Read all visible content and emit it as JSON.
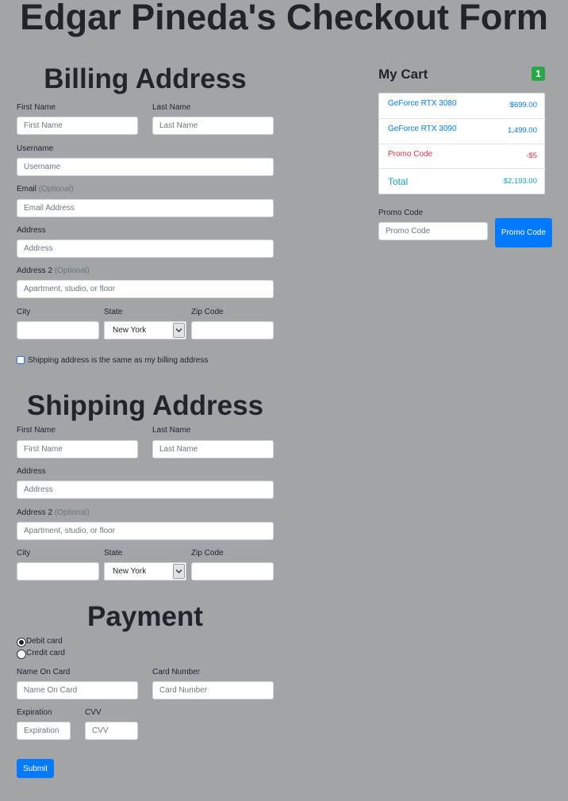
{
  "page_title": "Edgar Pineda's Checkout Form",
  "billing": {
    "title": "Billing Address",
    "first_name_label": "First Name",
    "first_name_placeholder": "First Name",
    "last_name_label": "Last Name",
    "last_name_placeholder": "Last Name",
    "username_label": "Username",
    "username_placeholder": "Username",
    "email_label": "Email",
    "email_optional": "(Optional)",
    "email_placeholder": "Email Address",
    "address_label": "Address",
    "address_placeholder": "Address",
    "address2_label": "Address 2",
    "address2_optional": "(Optional)",
    "address2_placeholder": "Apartment, studio, or floor",
    "city_label": "City",
    "state_label": "State",
    "state_value": "New York",
    "zip_label": "Zip Code",
    "same_address_label": "Shipping address is the same as my billing address",
    "same_address_checked": false
  },
  "shipping": {
    "title": "Shipping Address",
    "first_name_label": "First Name",
    "first_name_placeholder": "First Name",
    "last_name_label": "Last Name",
    "last_name_placeholder": "Last Name",
    "address_label": "Address",
    "address_placeholder": "Address",
    "address2_label": "Address 2",
    "address2_optional": "(Optional)",
    "address2_placeholder": "Apartment, studio, or floor",
    "city_label": "City",
    "state_label": "State",
    "state_value": "New York",
    "zip_label": "Zip Code"
  },
  "payment": {
    "title": "Payment",
    "methods": [
      {
        "label": "Debit card",
        "checked": true
      },
      {
        "label": "Credit card",
        "checked": false
      }
    ],
    "name_on_card_label": "Name On Card",
    "name_on_card_placeholder": "Name On Card",
    "card_number_label": "Card Number",
    "card_number_placeholder": "Card Number",
    "expiration_label": "Expiration",
    "expiration_placeholder": "Expiration",
    "cvv_label": "CVV",
    "cvv_placeholder": "CVV",
    "submit_label": "Submit"
  },
  "cart": {
    "title": "My Cart",
    "count": "1",
    "items": [
      {
        "name": "GeForce RTX 3080",
        "price": "$699.00"
      },
      {
        "name": "GeForce RTX 3090",
        "price": "1,499.00"
      }
    ],
    "promo_row": {
      "name": "Promo Code",
      "price": "-$5"
    },
    "total": {
      "name": "Total",
      "price": "$2,193.00"
    },
    "promo_label": "Promo Code",
    "promo_placeholder": "Promo Code",
    "promo_button": "Promo Code"
  },
  "colors": {
    "background": "#a2a4a8",
    "primary": "#007bff",
    "badge": "#28a745",
    "danger": "#dc3545",
    "info": "#17a2b8"
  }
}
